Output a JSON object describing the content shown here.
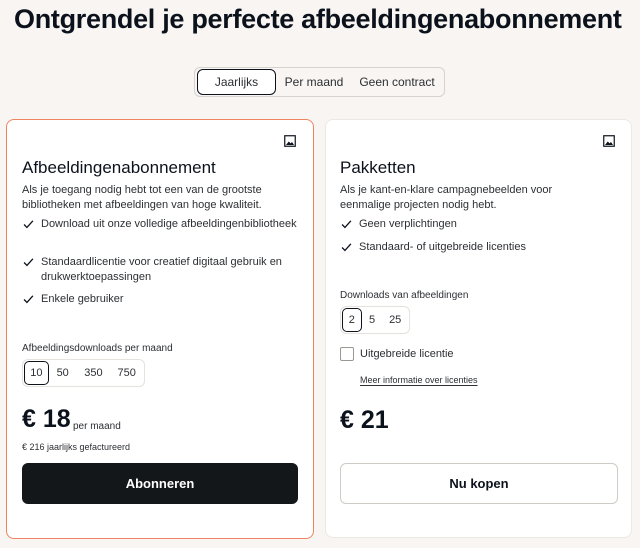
{
  "page_title": "Ontgrendel je perfecte afbeeldingenabonnement",
  "billing_toggle": {
    "options": [
      "Jaarlijks",
      "Per maand",
      "Geen contract"
    ],
    "selected": "Jaarlijks"
  },
  "subscription_card": {
    "title": "Afbeeldingenabonnement",
    "description": "Als je toegang nodig hebt tot een van de grootste bibliotheken met afbeeldingen van hoge kwaliteit.",
    "features": [
      "Download uit onze volledige afbeeldingenbibliotheek",
      "Standaardlicentie voor creatief digitaal gebruik en drukwerktoepassingen",
      "Enkele gebruiker"
    ],
    "downloads_label": "Afbeeldingsdownloads per maand",
    "download_options": [
      "10",
      "50",
      "350",
      "750"
    ],
    "selected_download": "10",
    "price": "€ 18",
    "price_period": "per maand",
    "billed_note": "€ 216 jaarlijks gefactureerd",
    "cta_label": "Abonneren"
  },
  "packs_card": {
    "title": "Pakketten",
    "description": "Als je kant-en-klare campagnebeelden voor eenmalige projecten nodig hebt.",
    "features": [
      "Geen verplichtingen",
      "Standaard- of uitgebreide licenties"
    ],
    "downloads_label": "Downloads van afbeeldingen",
    "download_options": [
      "2",
      "5",
      "25"
    ],
    "selected_download": "2",
    "extended_license_label": "Uitgebreide licentie",
    "extended_license_checked": false,
    "more_info_link": "Meer informatie over licenties",
    "price": "€ 21",
    "cta_label": "Nu kopen"
  },
  "colors": {
    "background": "#f8f5f2",
    "highlight_border": "#f08462",
    "primary_button": "#14171a",
    "text": "#0c121c"
  },
  "icons": [
    "image-icon",
    "check-icon"
  ]
}
